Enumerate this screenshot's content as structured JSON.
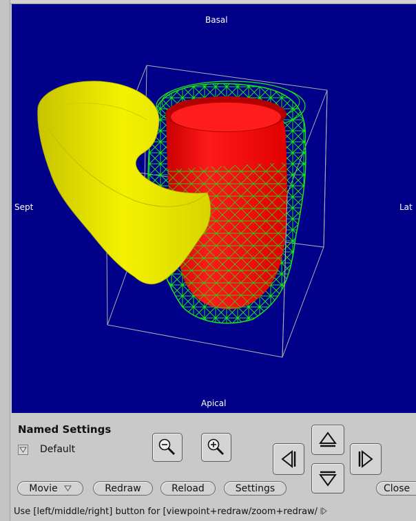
{
  "viewport": {
    "background": "#000088",
    "labels": {
      "top": "Basal",
      "bottom": "Apical",
      "left": "Sept",
      "right": "Lat"
    },
    "colors": {
      "rv_surface": "#f2f000",
      "lv_endo": "#ff0000",
      "lv_epi_wire": "#19e619",
      "bounding_box": "#b0b0b0"
    }
  },
  "panel": {
    "named_settings_title": "Named Settings",
    "selected_setting": "Default"
  },
  "toolbar": {
    "movie_label": "Movie",
    "redraw_label": "Redraw",
    "reload_label": "Reload",
    "settings_label": "Settings",
    "close_label": "Close"
  },
  "status": {
    "hint": "Use [left/middle/right] button for [viewpoint+redraw/zoom+redraw/"
  }
}
